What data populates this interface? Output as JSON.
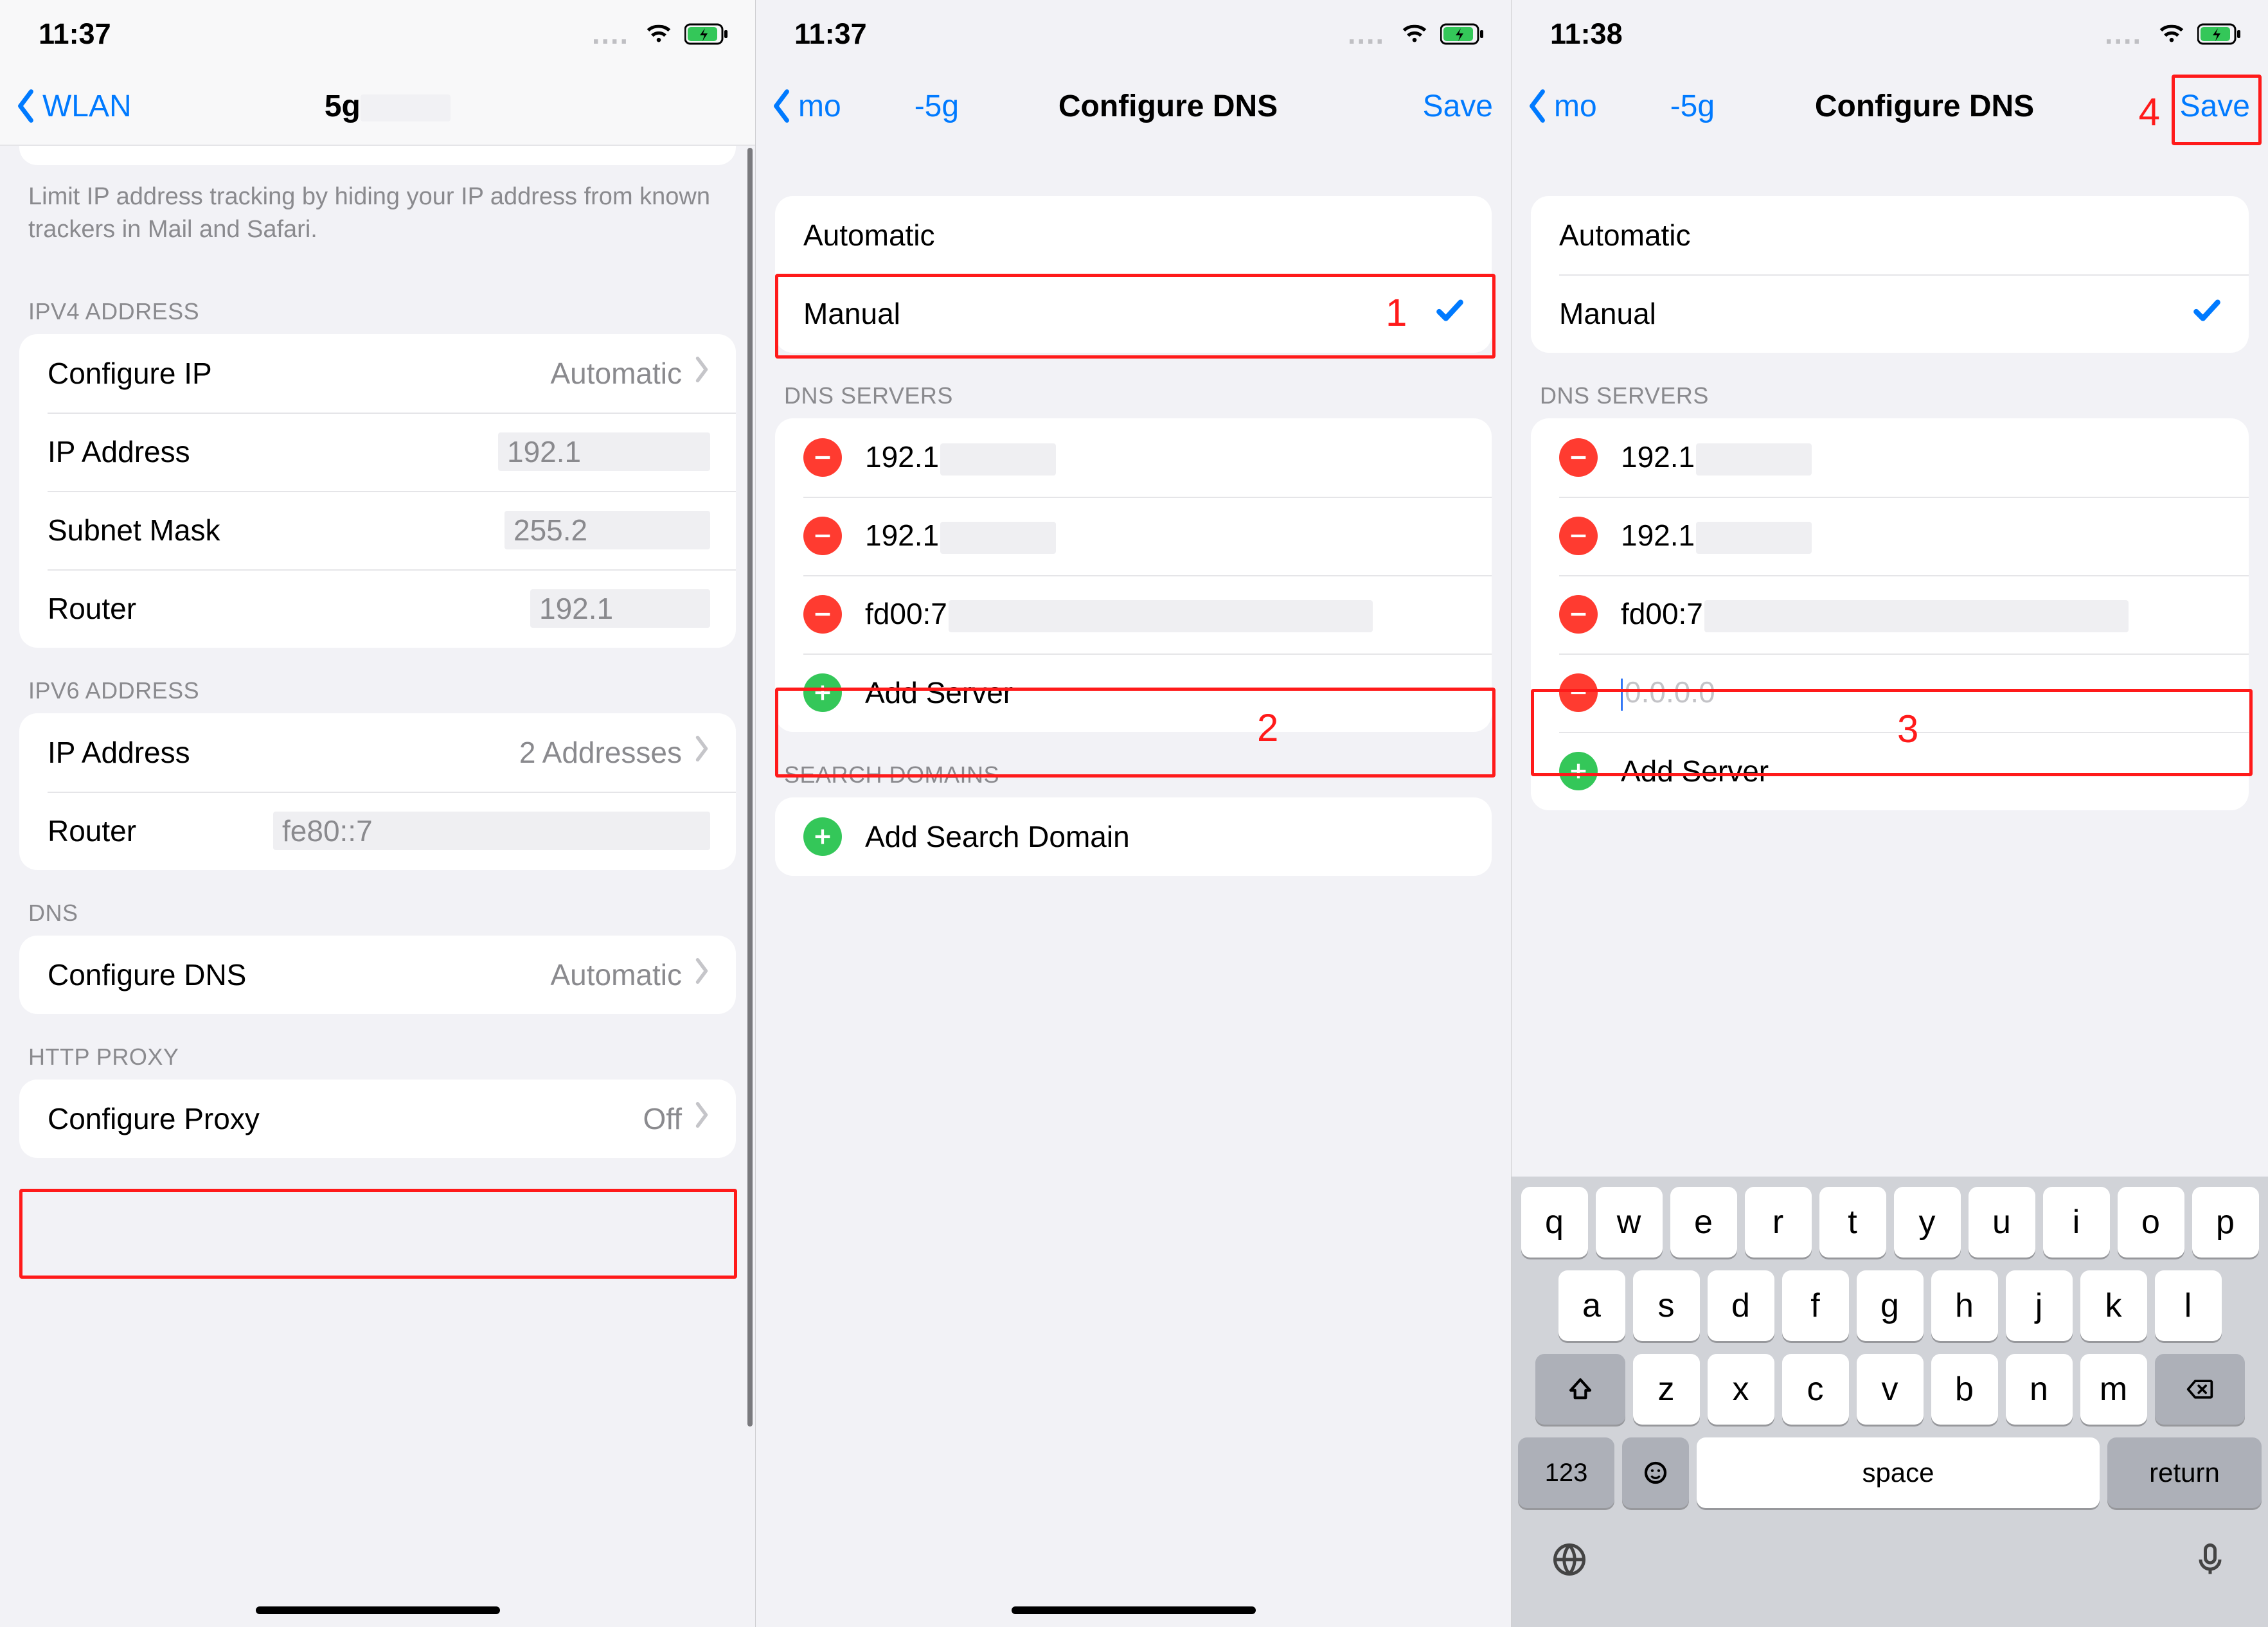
{
  "status": {
    "time1": "11:37",
    "time2": "11:37",
    "time3": "11:38",
    "dots": "...."
  },
  "panel1": {
    "back": "WLAN",
    "titleSuffix": "5g",
    "limitText": "Limit IP address tracking by hiding your IP address from known trackers in Mail and Safari.",
    "ipv4Header": "IPV4 ADDRESS",
    "configureIP": "Configure IP",
    "configureIPValue": "Automatic",
    "ipAddressLabel": "IP Address",
    "ipAddressValue": "192.1",
    "subnetLabel": "Subnet Mask",
    "subnetValue": "255.2",
    "routerLabel": "Router",
    "routerValue": "192.1",
    "ipv6Header": "IPV6 ADDRESS",
    "ipv6IPLabel": "IP Address",
    "ipv6IPValue": "2 Addresses",
    "ipv6RouterLabel": "Router",
    "ipv6RouterValue": "fe80::7",
    "dnsHeader": "DNS",
    "configureDNS": "Configure DNS",
    "configureDNSValue": "Automatic",
    "proxyHeader": "HTTP PROXY",
    "configureProxy": "Configure Proxy",
    "configureProxyValue": "Off"
  },
  "panel2": {
    "backPrefix": "mo",
    "backSuffix": "-5g",
    "title": "Configure DNS",
    "save": "Save",
    "automatic": "Automatic",
    "manual": "Manual",
    "dnsHeader": "DNS SERVERS",
    "dns1": "192.1",
    "dns2": "192.1",
    "dns3": "fd00:7",
    "addServer": "Add Server",
    "searchHeader": "SEARCH DOMAINS",
    "addSearch": "Add Search Domain"
  },
  "panel3": {
    "backPrefix": "mo",
    "backSuffix": "-5g",
    "title": "Configure DNS",
    "save": "Save",
    "automatic": "Automatic",
    "manual": "Manual",
    "dnsHeader": "DNS SERVERS",
    "dns1": "192.1",
    "dns2": "192.1",
    "dns3": "fd00:7",
    "placeholder": "0.0.0.0",
    "addServer": "Add Server"
  },
  "keyboard": {
    "row1": [
      "q",
      "w",
      "e",
      "r",
      "t",
      "y",
      "u",
      "i",
      "o",
      "p"
    ],
    "row2": [
      "a",
      "s",
      "d",
      "f",
      "g",
      "h",
      "j",
      "k",
      "l"
    ],
    "row3": [
      "z",
      "x",
      "c",
      "v",
      "b",
      "n",
      "m"
    ],
    "numKey": "123",
    "space": "space",
    "return": "return"
  },
  "annotations": {
    "n1": "1",
    "n2": "2",
    "n3": "3",
    "n4": "4"
  }
}
